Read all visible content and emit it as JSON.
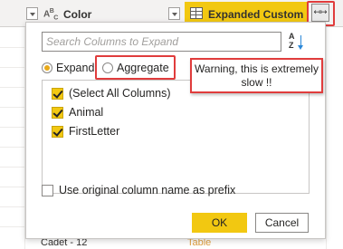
{
  "header": {
    "color_column_type": "ABC",
    "color_column_label": "Color",
    "expanded_column_label": "Expanded Custom",
    "expand_button_glyph": "↤↦"
  },
  "popup": {
    "search_placeholder": "Search Columns to Expand",
    "sort_glyph": "AZ",
    "radio_expand": "Expand",
    "radio_aggregate": "Aggregate",
    "selected_mode": "Expand",
    "columns": [
      {
        "label": "(Select All Columns)",
        "checked": true
      },
      {
        "label": "Animal",
        "checked": true
      },
      {
        "label": "FirstLetter",
        "checked": true
      }
    ],
    "prefix_label": "Use original column name as prefix",
    "prefix_checked": false,
    "ok_label": "OK",
    "cancel_label": "Cancel"
  },
  "warning": {
    "line1": "Warning, this is extremely",
    "line2": "slow !!"
  },
  "background_row": {
    "color_value": "Cadet - 12",
    "expanded_value": "Table"
  },
  "colors": {
    "accent": "#f2c811",
    "highlight": "#e03c3c",
    "link": "#e0a040"
  }
}
